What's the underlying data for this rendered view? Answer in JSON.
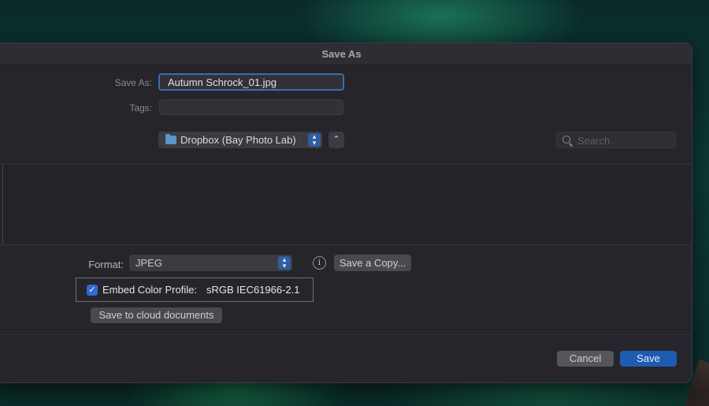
{
  "dialog": {
    "title": "Save As",
    "save_as_label": "Save As:",
    "save_as_value": "Autumn Schrock_01.jpg",
    "tags_label": "Tags:",
    "tags_value": "",
    "location": "Dropbox (Bay Photo Lab)",
    "location_icon": "folder-icon",
    "search_placeholder": "Search",
    "format_label": "Format:",
    "format_value": "JPEG",
    "info_glyph": "i",
    "save_copy_label": "Save a Copy...",
    "embed_checked": true,
    "embed_label": "Embed Color Profile:",
    "embed_value": "sRGB IEC61966-2.1",
    "cloud_button_label": "Save to cloud documents",
    "cancel_label": "Cancel",
    "save_label": "Save"
  },
  "colors": {
    "accent": "#1f5bb0",
    "dialog_bg": "#26252b",
    "checkbox": "#2f6ad0"
  }
}
